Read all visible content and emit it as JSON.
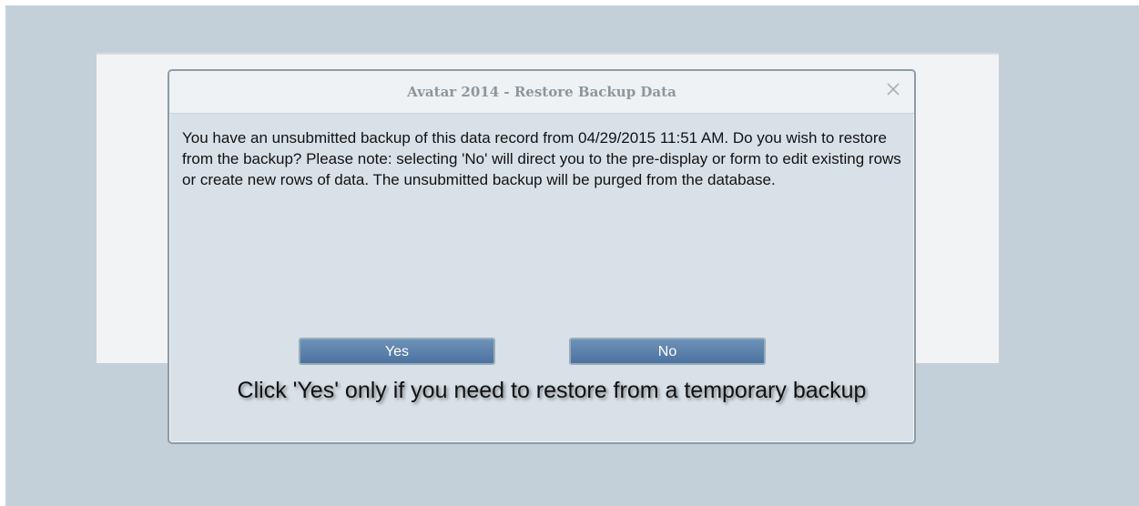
{
  "dialog": {
    "title": "Avatar 2014 - Restore Backup Data",
    "close_icon": "close-icon",
    "message": "You have an unsubmitted backup of this data record from 04/29/2015 11:51 AM. Do you wish to restore from the backup? Please note: selecting 'No' will direct you to the pre-display or form to edit existing rows or create new rows of data. The unsubmitted backup will be purged from the database.",
    "buttons": {
      "yes_label": "Yes",
      "no_label": "No"
    }
  },
  "annotation": {
    "text": "Click 'Yes' only if you need to restore from a temporary backup"
  },
  "colors": {
    "background": "#c4d0d9",
    "dialog_body": "#d8e1e8",
    "title_bar": "#eef2f5",
    "button": "#4f76a3"
  }
}
